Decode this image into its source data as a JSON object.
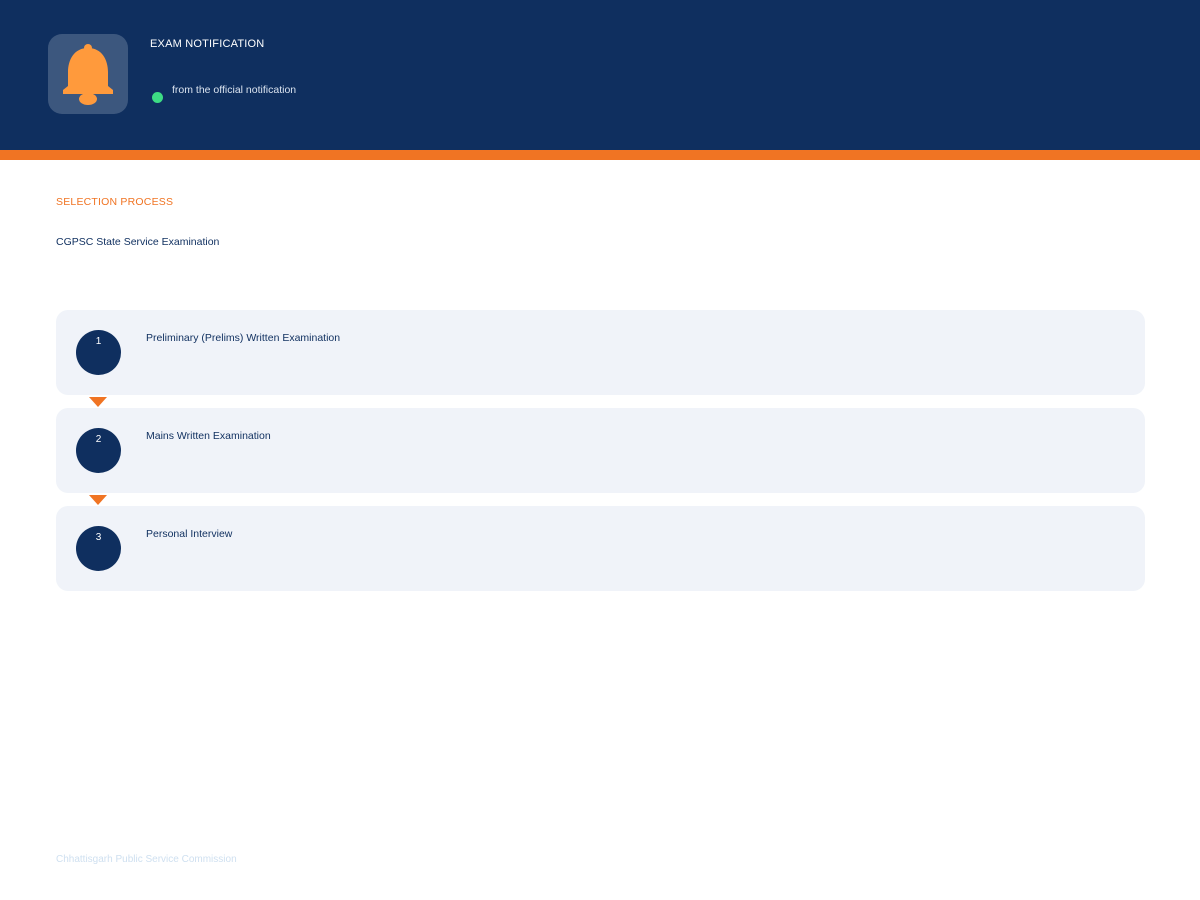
{
  "header": {
    "bell_icon": "bell-icon",
    "title": "EXAM NOTIFICATION",
    "status_text": "from the official notification"
  },
  "section": {
    "label": "SELECTION PROCESS",
    "title": "CGPSC State Service Examination"
  },
  "steps": [
    {
      "number": "1",
      "label": "Preliminary (Prelims) Written Examination"
    },
    {
      "number": "2",
      "label": "Mains Written Examination"
    },
    {
      "number": "3",
      "label": "Personal Interview"
    }
  ],
  "footer": {
    "text": "Chhattisgarh Public Service Commission"
  },
  "colors": {
    "navy": "#0f2f5f",
    "accent": "#f07423",
    "status": "#3ddc84",
    "card": "#f0f3f9"
  }
}
